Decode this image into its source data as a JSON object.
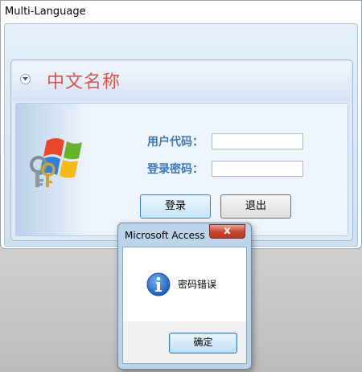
{
  "window": {
    "title": "Multi-Language"
  },
  "group": {
    "title": "中文名称"
  },
  "form": {
    "user_code_label": "用户代码：",
    "user_code_value": "",
    "password_label": "登录密码：",
    "password_value": ""
  },
  "buttons": {
    "login": "登录",
    "exit": "退出"
  },
  "dialog": {
    "title": "Microsoft Access",
    "close": "x",
    "message": "密码错误",
    "ok": "确定"
  },
  "icons": {
    "logo": "windows-keys-logo",
    "collapse": "chevron-down-icon",
    "info": "info-icon"
  },
  "colors": {
    "group_title": "#d9534f",
    "label": "#3c78b4"
  }
}
